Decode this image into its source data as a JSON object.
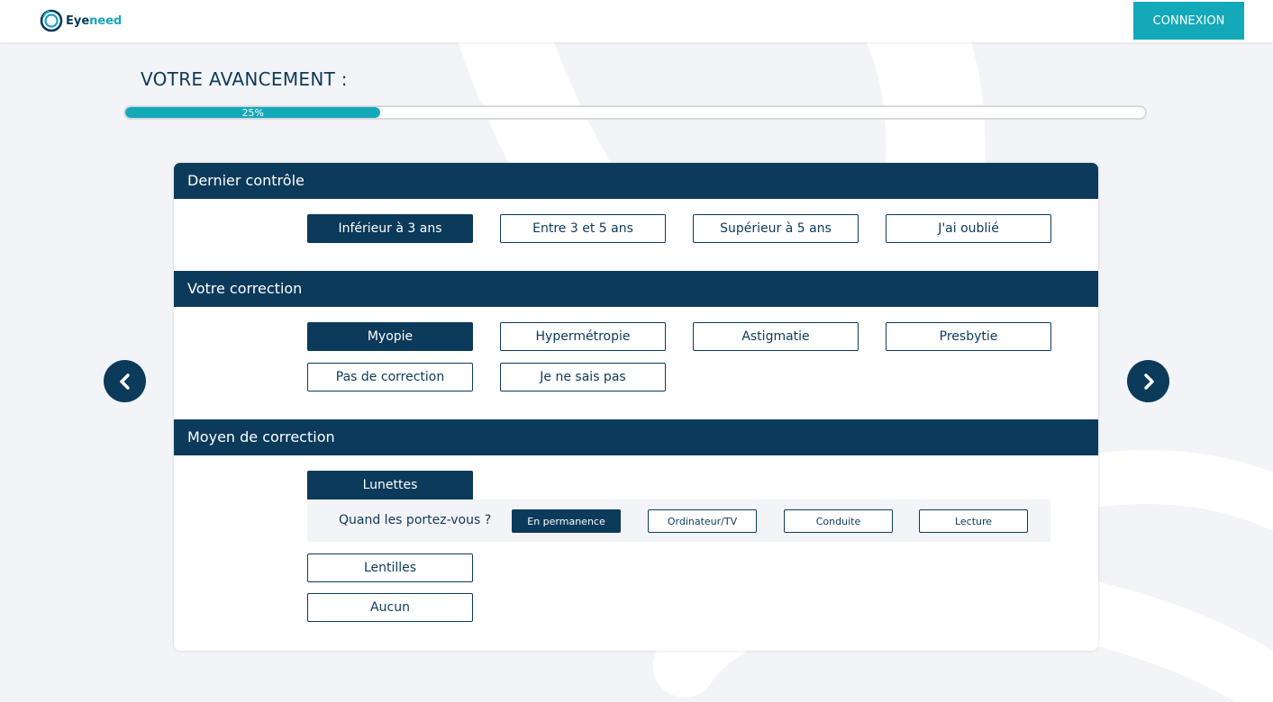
{
  "header": {
    "logo": {
      "prefix": "Eye",
      "suffix": "need"
    },
    "login_label": "CONNEXION"
  },
  "progress": {
    "title": "VOTRE AVANCEMENT :",
    "percent_label": "25%",
    "value": 0.25
  },
  "nav": {
    "prev_icon": "chevron-left-icon",
    "next_icon": "chevron-right-icon"
  },
  "sections": {
    "last_checkup": {
      "title": "Dernier contrôle",
      "options": [
        "Inférieur à 3 ans",
        "Entre 3 et 5 ans",
        "Supérieur à 5 ans",
        "J'ai oublié"
      ],
      "selected": "Inférieur à 3 ans"
    },
    "correction": {
      "title": "Votre correction",
      "options": [
        "Myopie",
        "Hypermétropie",
        "Astigmatie",
        "Presbytie",
        "Pas de correction",
        "Je ne sais pas"
      ],
      "selected": "Myopie"
    },
    "correction_means": {
      "title": "Moyen de correction",
      "glasses": {
        "label": "Lunettes",
        "question": "Quand les portez-vous ?",
        "options": [
          "En permanence",
          "Ordinateur/TV",
          "Conduite",
          "Lecture"
        ],
        "selected": "En permanence"
      },
      "other_options": [
        "Lentilles",
        "Aucun"
      ]
    }
  },
  "colors": {
    "navy": "#0b3a5b",
    "teal": "#13a9b9",
    "background": "#f3f4f8"
  }
}
